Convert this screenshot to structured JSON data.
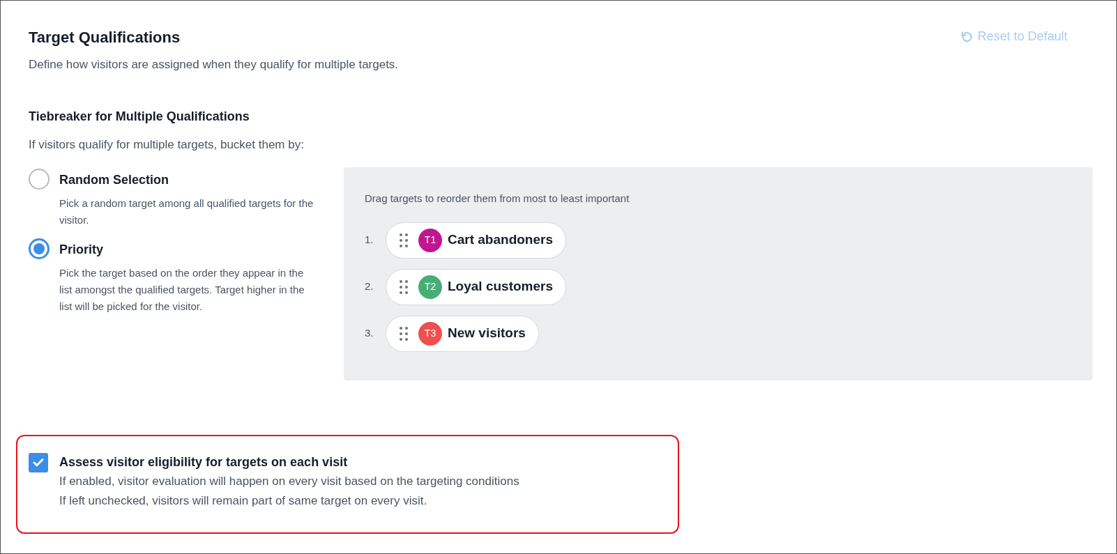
{
  "header": {
    "title": "Target Qualifications",
    "description": "Define how visitors are assigned when they qualify for multiple targets.",
    "reset_button": {
      "label": "Reset to Default",
      "disabled": true
    }
  },
  "tiebreaker": {
    "title": "Tiebreaker for Multiple Qualifications",
    "subtitle": "If visitors qualify for multiple targets, bucket them by:",
    "options": [
      {
        "label": "Random Selection",
        "description": "Pick a random target among all qualified targets for the visitor.",
        "selected": false
      },
      {
        "label": "Priority",
        "description": "Pick the target based on the order they appear in the list amongst the qualified targets. Target higher in the list will be picked for the visitor.",
        "selected": true
      }
    ]
  },
  "priority_list": {
    "hint": "Drag targets to reorder them from most to least important",
    "items": [
      {
        "number": "1.",
        "badge": "T1",
        "name": "Cart abandoners",
        "color": "#c0168f"
      },
      {
        "number": "2.",
        "badge": "T2",
        "name": "Loyal customers",
        "color": "#47ad76"
      },
      {
        "number": "3.",
        "badge": "T3",
        "name": "New visitors",
        "color": "#ef4f4f"
      }
    ]
  },
  "eligibility": {
    "checked": true,
    "label": "Assess visitor eligibility for targets on each visit",
    "lines": [
      "If enabled, visitor evaluation will happen on every visit based on the targeting conditions",
      "If left unchecked, visitors will remain part of same target on every visit."
    ]
  }
}
